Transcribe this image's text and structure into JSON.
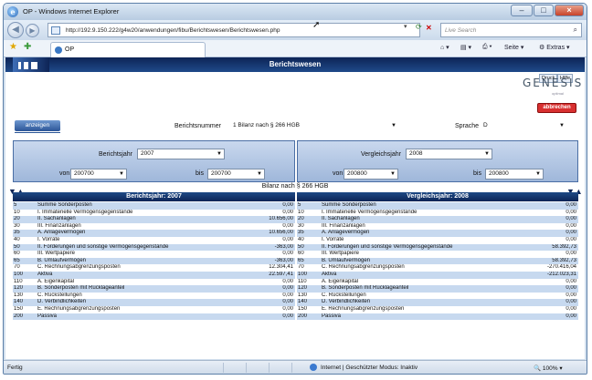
{
  "window": {
    "title": "OP - Windows Internet Explorer",
    "minimize": "–",
    "maximize": "□",
    "close": "×"
  },
  "browser": {
    "url": "http://192.9.150.222/g4w20/anwendungen/fibu/Berichtswesen/Berichtswesen.php",
    "search_placeholder": "Live Search",
    "tab_label": "OP",
    "commands": {
      "page": "Seite",
      "tools": "Extras"
    }
  },
  "app": {
    "header_title": "Berichtswesen",
    "mini_buttons": [
      "Druck",
      "Hilfe"
    ],
    "logo": "GENESIS",
    "logo_sub": "optimal",
    "cancel_label": "abbrechen",
    "show_label": "anzeigen",
    "report_number_label": "Berichtsnummer",
    "report_number_value": "1 Bilanz nach § 266 HGB",
    "language_label": "Sprache",
    "language_value": "D",
    "left_panel": {
      "year_label": "Berichtsjahr",
      "year_value": "2007",
      "from_label": "von",
      "from_value": "200700",
      "to_label": "bis",
      "to_value": "200700"
    },
    "right_panel": {
      "year_label": "Vergleichsjahr",
      "year_value": "2008",
      "from_label": "von",
      "from_value": "200800",
      "to_label": "bis",
      "to_value": "200800"
    },
    "caption": "Bilanz nach § 266 HGB",
    "left_table_header": "Berichtsjahr: 2007",
    "right_table_header": "Vergleichsjahr: 2008",
    "left_rows": [
      {
        "code": "5",
        "label": "Summe Sonderposten",
        "value": "0,00"
      },
      {
        "code": "10",
        "label": "I. Immaterielle Vermögensgegenstände",
        "value": "0,00"
      },
      {
        "code": "20",
        "label": "II. Sachanlagen",
        "value": "10.656,00"
      },
      {
        "code": "30",
        "label": "III. Finanzanlagen",
        "value": "0,00"
      },
      {
        "code": "35",
        "label": "A. Anlagevermögen",
        "value": "10.656,00"
      },
      {
        "code": "40",
        "label": "I. Vorräte",
        "value": "0,00"
      },
      {
        "code": "50",
        "label": "II. Forderungen und sonstige Vermögensgegenstände",
        "value": "-363,00"
      },
      {
        "code": "60",
        "label": "III. Wertpapiere",
        "value": "0,00"
      },
      {
        "code": "65",
        "label": "B. Umlaufvermögen",
        "value": "-363,00"
      },
      {
        "code": "70",
        "label": "C. Rechnungsabgrenzungsposten",
        "value": "12.304,41"
      },
      {
        "code": "100",
        "label": "Aktiva",
        "value": "22.597,41"
      },
      {
        "code": "110",
        "label": "A. Eigenkapital",
        "value": "0,00"
      },
      {
        "code": "120",
        "label": "B. Sonderposten mit Rücklageanteil",
        "value": "0,00"
      },
      {
        "code": "130",
        "label": "C. Rückstellungen",
        "value": "0,00"
      },
      {
        "code": "140",
        "label": "D. Verbindlichkeiten",
        "value": "0,00"
      },
      {
        "code": "150",
        "label": "E. Rechnungsabgrenzungsposten",
        "value": "0,00"
      },
      {
        "code": "200",
        "label": "Passiva",
        "value": "0,00"
      }
    ],
    "right_rows": [
      {
        "code": "5",
        "label": "Summe Sonderposten",
        "value": "0,00"
      },
      {
        "code": "10",
        "label": "I. Immaterielle Vermögensgegenstände",
        "value": "0,00"
      },
      {
        "code": "20",
        "label": "II. Sachanlagen",
        "value": "0,00"
      },
      {
        "code": "30",
        "label": "III. Finanzanlagen",
        "value": "0,00"
      },
      {
        "code": "35",
        "label": "A. Anlagevermögen",
        "value": "0,00"
      },
      {
        "code": "40",
        "label": "I. Vorräte",
        "value": "0,00"
      },
      {
        "code": "50",
        "label": "II. Forderungen und sonstige Vermögensgegenstände",
        "value": "58.392,73"
      },
      {
        "code": "60",
        "label": "III. Wertpapiere",
        "value": "0,00"
      },
      {
        "code": "65",
        "label": "B. Umlaufvermögen",
        "value": "58.392,73"
      },
      {
        "code": "70",
        "label": "C. Rechnungsabgrenzungsposten",
        "value": "-270.416,04"
      },
      {
        "code": "100",
        "label": "Aktiva",
        "value": "-212.023,31"
      },
      {
        "code": "110",
        "label": "A. Eigenkapital",
        "value": "0,00"
      },
      {
        "code": "120",
        "label": "B. Sonderposten mit Rücklageanteil",
        "value": "0,00"
      },
      {
        "code": "130",
        "label": "C. Rückstellungen",
        "value": "0,00"
      },
      {
        "code": "140",
        "label": "D. Verbindlichkeiten",
        "value": "0,00"
      },
      {
        "code": "150",
        "label": "E. Rechnungsabgrenzungsposten",
        "value": "0,00"
      },
      {
        "code": "200",
        "label": "Passiva",
        "value": "0,00"
      }
    ]
  },
  "status": {
    "left": "Fertig",
    "zone": "Internet | Geschützter Modus: Inaktiv",
    "zoom": "100%"
  },
  "colors": {
    "header_dark": "#0d2456",
    "row_alt": "#c7d9ef",
    "cancel_red": "#d83030"
  }
}
